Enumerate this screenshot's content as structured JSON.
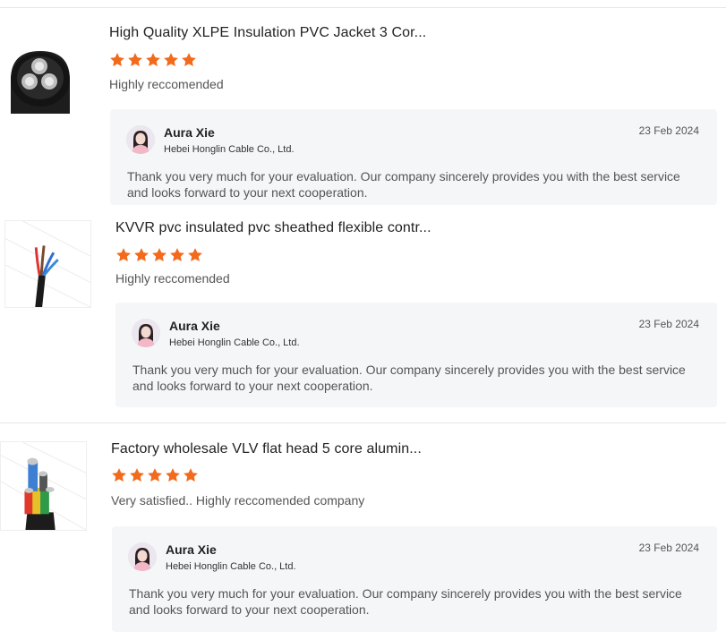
{
  "reviews": [
    {
      "product_title": "High Quality XLPE Insulation PVC Jacket 3 Cor...",
      "rating": 5,
      "rating_max": 5,
      "comment": "Highly reccomended",
      "reply": {
        "name": "Aura Xie",
        "company": "Hebei Honglin Cable Co., Ltd.",
        "date": "23 Feb 2024",
        "text": "Thank you very much for your evaluation. Our company sincerely provides you with the best service and looks forward to your next cooperation."
      }
    },
    {
      "product_title": "KVVR pvc insulated pvc sheathed flexible contr...",
      "rating": 5,
      "rating_max": 5,
      "comment": "Highly reccomended",
      "reply": {
        "name": "Aura Xie",
        "company": "Hebei Honglin Cable Co., Ltd.",
        "date": "23 Feb 2024",
        "text": "Thank you very much for your evaluation. Our company sincerely provides you with the best service and looks forward to your next cooperation."
      }
    },
    {
      "product_title": "Factory wholesale VLV flat head 5 core alumin...",
      "rating": 5,
      "rating_max": 5,
      "comment": "Very satisfied.. Highly reccomended company",
      "reply": {
        "name": "Aura Xie",
        "company": "Hebei Honglin Cable Co., Ltd.",
        "date": "23 Feb 2024",
        "text": "Thank you very much for your evaluation. Our company sincerely provides you with the best service and looks forward to your next cooperation."
      }
    }
  ],
  "colors": {
    "star": "#f26b1d",
    "reply_bg": "#f5f6f8",
    "divider": "#e6e6e6"
  },
  "icons": {
    "star": "star-icon",
    "avatar": "avatar-image"
  }
}
